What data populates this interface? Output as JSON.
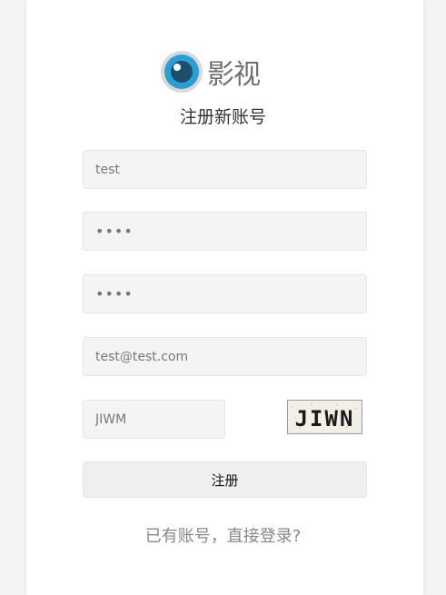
{
  "brand": {
    "name": "影视"
  },
  "page": {
    "heading": "注册新账号"
  },
  "form": {
    "username": {
      "value": "test"
    },
    "password": {
      "value": "••••"
    },
    "confirm_password": {
      "value": "••••"
    },
    "email": {
      "value": "test@test.com"
    },
    "captcha_input": {
      "value": "JIWM"
    },
    "captcha_image_text": "JIWN",
    "submit_label": "注册"
  },
  "footer": {
    "login_link": "已有账号，直接登录?"
  },
  "colors": {
    "logo_blue": "#2a9fd6",
    "logo_dark": "#1d4e6b",
    "field_bg": "#f4f4f4"
  }
}
